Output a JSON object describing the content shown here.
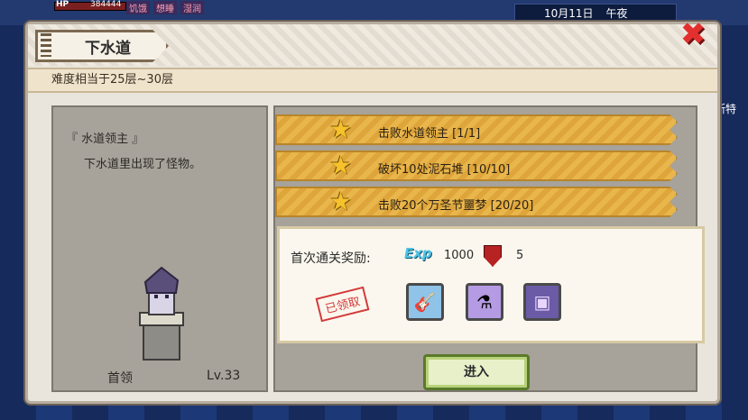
{
  "hud": {
    "hp_label": "HP",
    "hp_value": "384444",
    "status_tags": [
      "饥饿",
      "想睡",
      "湿润"
    ],
    "date": "10月11日",
    "time_of_day": "午夜",
    "side_name": "斯特"
  },
  "dialog": {
    "title": "下水道",
    "difficulty": "难度相当于25层~30层",
    "close_icon": "close-icon"
  },
  "boss": {
    "name": "『 水道领主 』",
    "description": "下水道里出现了怪物。",
    "label": "首领",
    "level": "Lv.33"
  },
  "objectives": [
    {
      "text": "击败水道领主 [1/1]",
      "icon": "star-icon"
    },
    {
      "text": "破坏10处泥石堆 [10/10]",
      "icon": "star-icon"
    },
    {
      "text": "击败20个万圣节噩梦 [20/20]",
      "icon": "star-icon"
    }
  ],
  "rewards": {
    "label": "首次通关奖励:",
    "exp_icon_text": "Exp",
    "exp_value": "1000",
    "shield_value": "5",
    "claimed_stamp": "已领取",
    "items": [
      {
        "name": "guitar-scroll-item",
        "color": "#8fc3e8"
      },
      {
        "name": "potion-item",
        "color": "#b59be3"
      },
      {
        "name": "treasure-chest-item",
        "color": "#6b5aa6"
      }
    ]
  },
  "actions": {
    "enter_label": "进入"
  }
}
